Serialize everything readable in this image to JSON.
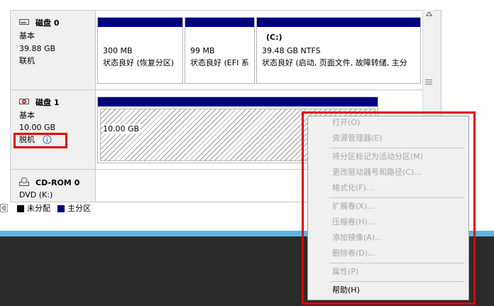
{
  "disks": [
    {
      "name": "磁盘 0",
      "type": "基本",
      "size": "39.88 GB",
      "status": "联机",
      "icon": "hard-disk-icon"
    },
    {
      "name": "磁盘 1",
      "type": "基本",
      "size": "10.00 GB",
      "status": "脱机",
      "icon": "hard-disk-offline-icon",
      "status_icon": "info-icon"
    },
    {
      "name": "CD-ROM 0",
      "type": "DVD (K:)",
      "icon": "cdrom-icon"
    }
  ],
  "partitions_disk0": [
    {
      "label": "",
      "size": "300 MB",
      "status": "状态良好 (恢复分区)"
    },
    {
      "label": "",
      "size": "99 MB",
      "status": "状态良好 (EFI 系"
    },
    {
      "label": "(C:)",
      "size": "39.48 GB NTFS",
      "status": "状态良好 (启动, 页面文件, 故障转储, 主分"
    }
  ],
  "partition_disk1": {
    "size": "10.00 GB"
  },
  "legend": [
    {
      "label": "未分配",
      "color": "#000000"
    },
    {
      "label": "主分区",
      "color": "#00007e"
    }
  ],
  "context_menu": [
    {
      "label": "打开(O)",
      "enabled": false
    },
    {
      "label": "资源管理器(E)",
      "enabled": false
    },
    {
      "label": "将分区标记为活动分区(M)",
      "enabled": false
    },
    {
      "label": "更改驱动器号和路径(C)...",
      "enabled": false
    },
    {
      "label": "格式化(F)...",
      "enabled": false
    },
    {
      "label": "扩展卷(X)...",
      "enabled": false
    },
    {
      "label": "压缩卷(H)...",
      "enabled": false
    },
    {
      "label": "添加镜像(A)...",
      "enabled": false
    },
    {
      "label": "删除卷(D)...",
      "enabled": false
    },
    {
      "label": "属性(P)",
      "enabled": false
    },
    {
      "label": "帮助(H)",
      "enabled": true
    }
  ],
  "colors": {
    "primary_partition": "#00007e",
    "highlight": "#e00000",
    "taskbar_accent": "#5ab6dd"
  }
}
